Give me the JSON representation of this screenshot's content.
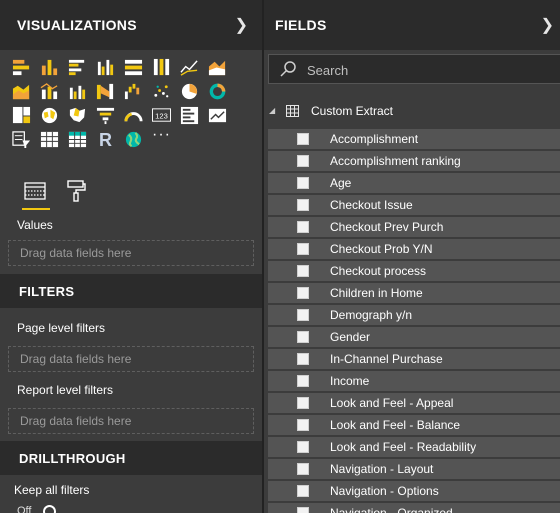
{
  "visualizations": {
    "title": "VISUALIZATIONS",
    "collapse_icon": "chevron-right-icon",
    "icons": [
      [
        "stacked-bar-icon",
        "stacked-column-icon",
        "clustered-bar-icon",
        "clustered-column-icon",
        "100-stacked-bar-icon",
        "100-stacked-column-icon",
        "line-chart-icon",
        "area-chart-icon"
      ],
      [
        "stacked-area-icon",
        "line-and-stacked-column-icon",
        "line-and-clustered-column-icon",
        "ribbon-chart-icon",
        "waterfall-icon",
        "scatter-chart-icon",
        "pie-chart-icon",
        "donut-chart-icon"
      ],
      [
        "treemap-icon",
        "map-icon",
        "filled-map-icon",
        "funnel-icon",
        "gauge-icon",
        "card-icon",
        "multi-row-card-icon",
        "kpi-icon"
      ],
      [
        "slicer-icon",
        "table-icon",
        "matrix-icon",
        "r-script-icon",
        "globe-icon",
        "more-icon"
      ]
    ],
    "more_glyph": "···",
    "r_glyph": "R",
    "card_glyph": "123"
  },
  "tabs": {
    "fields_icon": "fields-tab-icon",
    "format_icon": "format-paint-roller-icon"
  },
  "values": {
    "label": "Values",
    "placeholder": "Drag data fields here"
  },
  "filters": {
    "title": "FILTERS",
    "page_label": "Page level filters",
    "page_placeholder": "Drag data fields here",
    "report_label": "Report level filters",
    "report_placeholder": "Drag data fields here"
  },
  "drillthrough": {
    "title": "DRILLTHROUGH",
    "keep_label": "Keep all filters",
    "toggle_state": "Off"
  },
  "fields": {
    "title": "FIELDS",
    "collapse_icon": "chevron-right-icon",
    "search_placeholder": "Search",
    "table_name": "Custom Extract",
    "items": [
      "Accomplishment",
      "Accomplishment ranking",
      "Age",
      "Checkout Issue",
      "Checkout Prev Purch",
      "Checkout Prob Y/N",
      "Checkout process",
      "Children in Home",
      "Demograph y/n",
      "Gender",
      "In-Channel Purchase",
      "Income",
      "Look and Feel - Appeal",
      "Look and Feel - Balance",
      "Look and Feel - Readability",
      "Navigation - Layout",
      "Navigation - Options",
      "Navigation - Organized"
    ]
  },
  "colors": {
    "accent": "#f2c811",
    "blue": "#01b8aa",
    "orange": "#f2a33a",
    "panel": "#3c3c3c",
    "header": "#2b2b2b"
  }
}
